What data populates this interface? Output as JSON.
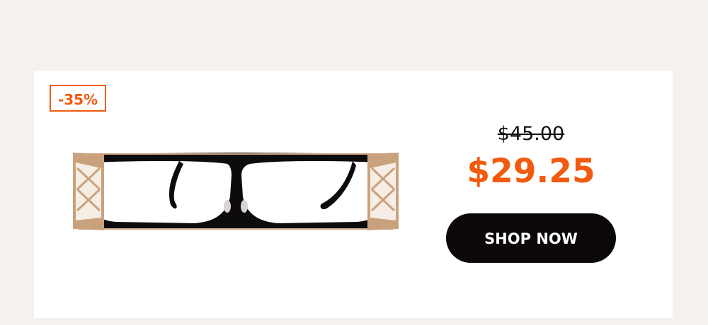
{
  "promo": {
    "discount_badge": "-35%",
    "original_price": "$45.00",
    "sale_price": "$29.25",
    "cta_label": "SHOP NOW"
  },
  "product": {
    "image_icon": "eyeglasses-icon",
    "frame_color": "#0d0b0c",
    "accent_color": "#c9a27d"
  },
  "colors": {
    "accent": "#f15a0f",
    "button_bg": "#0c0809",
    "page_bg": "#f4f1ee",
    "card_bg": "#ffffff"
  }
}
